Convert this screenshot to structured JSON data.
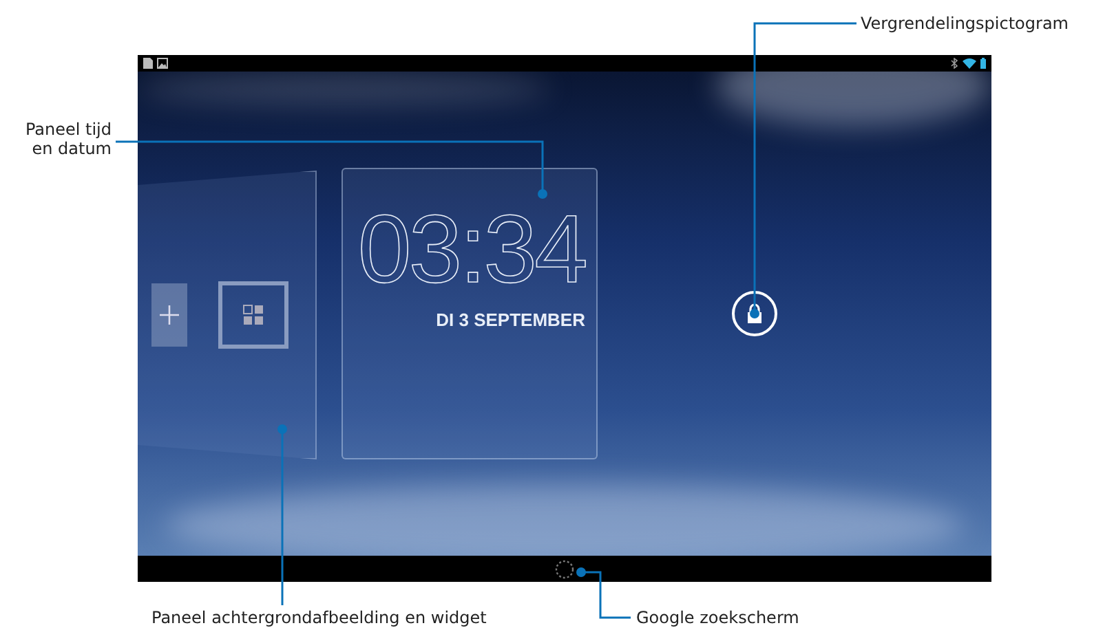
{
  "callouts": [
    {
      "kind": "lock",
      "text": "Vergrendelingspictogram"
    },
    {
      "kind": "clock",
      "text": "Paneel tijd en datum"
    },
    {
      "kind": "widget",
      "text": "Paneel achtergrondafbeelding en widget"
    },
    {
      "kind": "search",
      "text": "Google zoekscherm"
    }
  ],
  "screen": {
    "clock": {
      "time": "03:34",
      "date": "DI 3 SEPTEMBER"
    }
  }
}
